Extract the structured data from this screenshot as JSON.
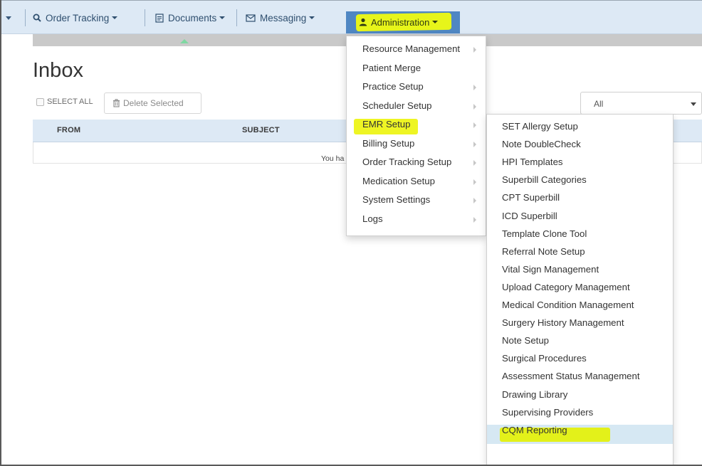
{
  "nav": {
    "order_tracking": "Order Tracking",
    "documents": "Documents",
    "messaging": "Messaging",
    "administration": "Administration"
  },
  "inbox": {
    "title": "Inbox",
    "select_all": "SELECT ALL",
    "delete_selected": "Delete Selected",
    "filter_value": "All",
    "columns": {
      "from": "FROM",
      "subject": "SUBJECT"
    },
    "empty_message": "You ha"
  },
  "admin_menu": [
    {
      "label": "Resource Management",
      "has_submenu": true
    },
    {
      "label": "Patient Merge",
      "has_submenu": false
    },
    {
      "label": "Practice Setup",
      "has_submenu": true
    },
    {
      "label": "Scheduler Setup",
      "has_submenu": true
    },
    {
      "label": "EMR Setup",
      "has_submenu": true,
      "highlighted": true
    },
    {
      "label": "Billing Setup",
      "has_submenu": true
    },
    {
      "label": "Order Tracking Setup",
      "has_submenu": true
    },
    {
      "label": "Medication Setup",
      "has_submenu": true
    },
    {
      "label": "System Settings",
      "has_submenu": true
    },
    {
      "label": "Logs",
      "has_submenu": true
    }
  ],
  "emr_menu": [
    {
      "label": "SET Allergy Setup"
    },
    {
      "label": "Note DoubleCheck"
    },
    {
      "label": "HPI Templates"
    },
    {
      "label": "Superbill Categories"
    },
    {
      "label": "CPT Superbill"
    },
    {
      "label": "ICD Superbill"
    },
    {
      "label": "Template Clone Tool"
    },
    {
      "label": "Referral Note Setup"
    },
    {
      "label": "Vital Sign Management"
    },
    {
      "label": "Upload Category Management"
    },
    {
      "label": "Medical Condition Management"
    },
    {
      "label": "Surgery History Management"
    },
    {
      "label": "Note Setup"
    },
    {
      "label": "Surgical Procedures"
    },
    {
      "label": "Assessment Status Management"
    },
    {
      "label": "Drawing Library"
    },
    {
      "label": "Supervising Providers",
      "active": true
    },
    {
      "label": "CQM Reporting"
    }
  ],
  "colors": {
    "nav_bg": "#dde9f5",
    "admin_active_bg": "#4f87c3",
    "highlighter": "#e7f51a",
    "active_row": "#d6e8f3"
  },
  "icons": {
    "order_tracking": "search-icon",
    "documents": "document-icon",
    "messaging": "envelope-icon",
    "administration": "user-icon",
    "delete": "trash-icon"
  }
}
